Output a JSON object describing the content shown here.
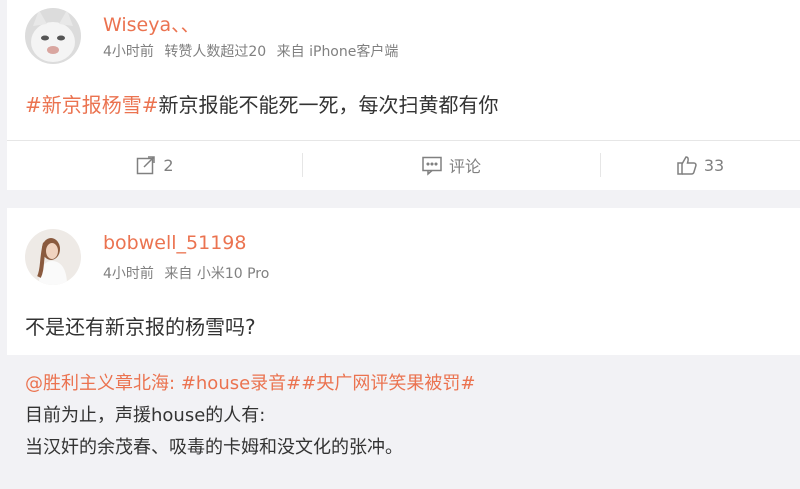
{
  "posts": [
    {
      "username": "Wiseya、、",
      "time": "4小时前",
      "reposts_note": "转赞人数超过20",
      "source": "来自 iPhone客户端",
      "hashtag": "#新京报杨雪#",
      "text": "新京报能不能死一死，每次扫黄都有你",
      "actions": {
        "repost_count": "2",
        "comment_label": "评论",
        "like_count": "33"
      }
    },
    {
      "username": "bobwell_51198",
      "time": "4小时前",
      "source": "来自 小米10 Pro",
      "text": "不是还有新京报的杨雪吗?",
      "quote": {
        "author": "@胜利主义章北海",
        "colon": ":",
        "hashtags": "#house录音##央广网评笑果被罚#",
        "line2": "目前为止，声援house的人有:",
        "line3": "当汉奸的余茂春、吸毒的卡姆和没文化的张冲。"
      }
    }
  ],
  "colors": {
    "accent": "#eb7350",
    "meta": "#808080",
    "background": "#f2f2f5"
  },
  "icons": [
    "repost-icon",
    "comment-icon",
    "like-icon"
  ]
}
